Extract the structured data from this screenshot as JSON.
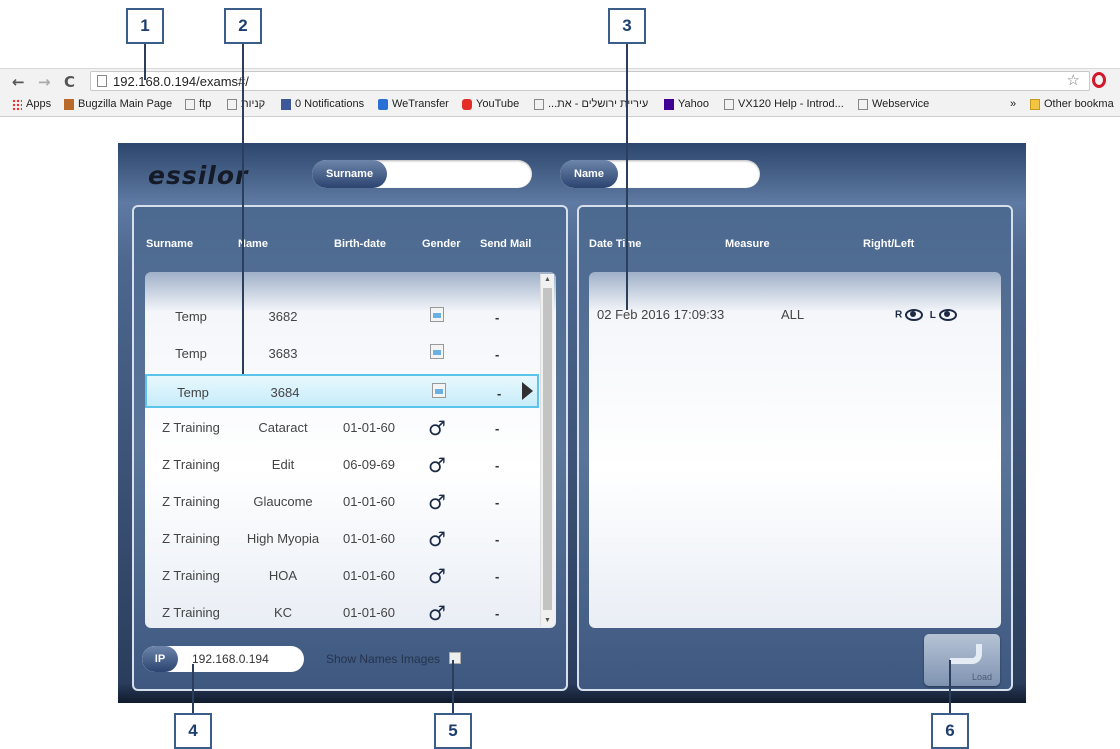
{
  "callouts": [
    "1",
    "2",
    "3",
    "4",
    "5",
    "6"
  ],
  "browser": {
    "url": "192.168.0.194/exams#/",
    "nav": {
      "back": "←",
      "forward": "→",
      "reload": "C"
    },
    "bookmarks": [
      "Apps",
      "Bugzilla Main Page",
      "ftp",
      "קניות",
      "0 Notifications",
      "WeTransfer",
      "YouTube",
      "...עיריית ירושלים - את",
      "Yahoo",
      "VX120 Help - Introd...",
      "Webservice"
    ],
    "more": "»",
    "other_bookmarks": "Other bookma"
  },
  "app": {
    "logo": "essilor",
    "search": {
      "surname_label": "Surname",
      "name_label": "Name"
    },
    "patients": {
      "headers": {
        "surname": "Surname",
        "name": "Name",
        "birth": "Birth-date",
        "gender": "Gender",
        "send_mail": "Send Mail"
      },
      "rows": [
        {
          "surname": "Temp",
          "name": "3682",
          "birth": "",
          "gender": "image",
          "send": "-"
        },
        {
          "surname": "Temp",
          "name": "3683",
          "birth": "",
          "gender": "image",
          "send": "-"
        },
        {
          "surname": "Temp",
          "name": "3684",
          "birth": "",
          "gender": "image",
          "send": "-"
        },
        {
          "surname": "Z Training",
          "name": "Cataract",
          "birth": "01-01-60",
          "gender": "male-icon",
          "send": "-"
        },
        {
          "surname": "Z Training",
          "name": "Edit",
          "birth": "06-09-69",
          "gender": "male-icon",
          "send": "-"
        },
        {
          "surname": "Z Training",
          "name": "Glaucome",
          "birth": "01-01-60",
          "gender": "male-icon",
          "send": "-"
        },
        {
          "surname": "Z Training",
          "name": "High Myopia",
          "birth": "01-01-60",
          "gender": "male-icon",
          "send": "-"
        },
        {
          "surname": "Z Training",
          "name": "HOA",
          "birth": "01-01-60",
          "gender": "male-icon",
          "send": "-"
        },
        {
          "surname": "Z Training",
          "name": "KC",
          "birth": "01-01-60",
          "gender": "male-icon",
          "send": "-"
        }
      ],
      "selected_index": 2
    },
    "exams": {
      "headers": {
        "datetime": "Date Time",
        "measure": "Measure",
        "rightleft": "Right/Left"
      },
      "rows": [
        {
          "datetime": "02 Feb 2016 17:09:33",
          "measure": "ALL",
          "right": "R",
          "left": "L"
        }
      ]
    },
    "ip": {
      "label": "IP",
      "value": "192.168.0.194"
    },
    "show_names": "Show Names Images",
    "load_label": "Load"
  }
}
